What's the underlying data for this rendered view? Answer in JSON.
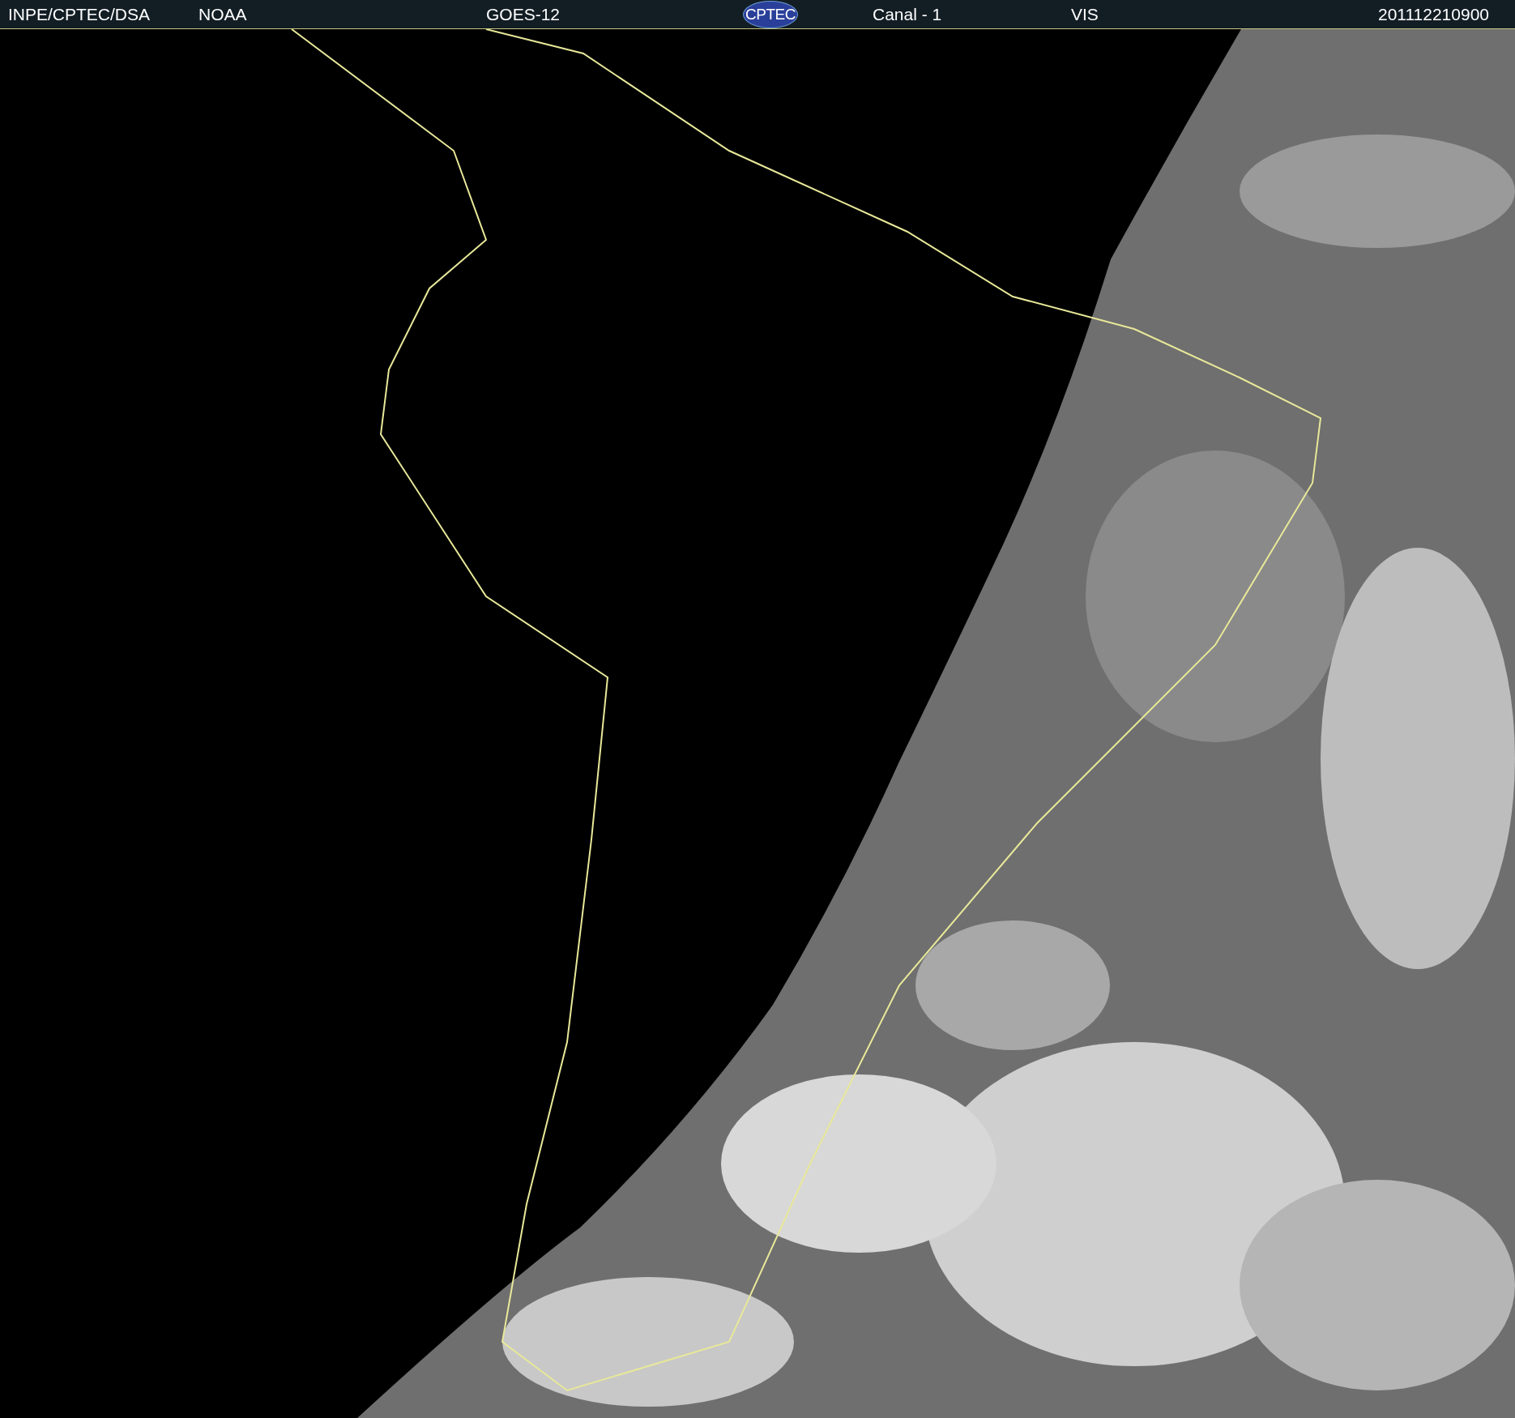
{
  "header": {
    "items": [
      {
        "kind": "text",
        "text": "INPE/CPTEC/DSA"
      },
      {
        "kind": "text",
        "text": "NOAA"
      },
      {
        "kind": "text",
        "text": "GOES-12"
      },
      {
        "kind": "logo",
        "text": "CPTEC"
      },
      {
        "kind": "text",
        "text": "Canal - 1"
      },
      {
        "kind": "text",
        "text": "VIS"
      },
      {
        "kind": "text",
        "text": "201112210900"
      }
    ]
  }
}
